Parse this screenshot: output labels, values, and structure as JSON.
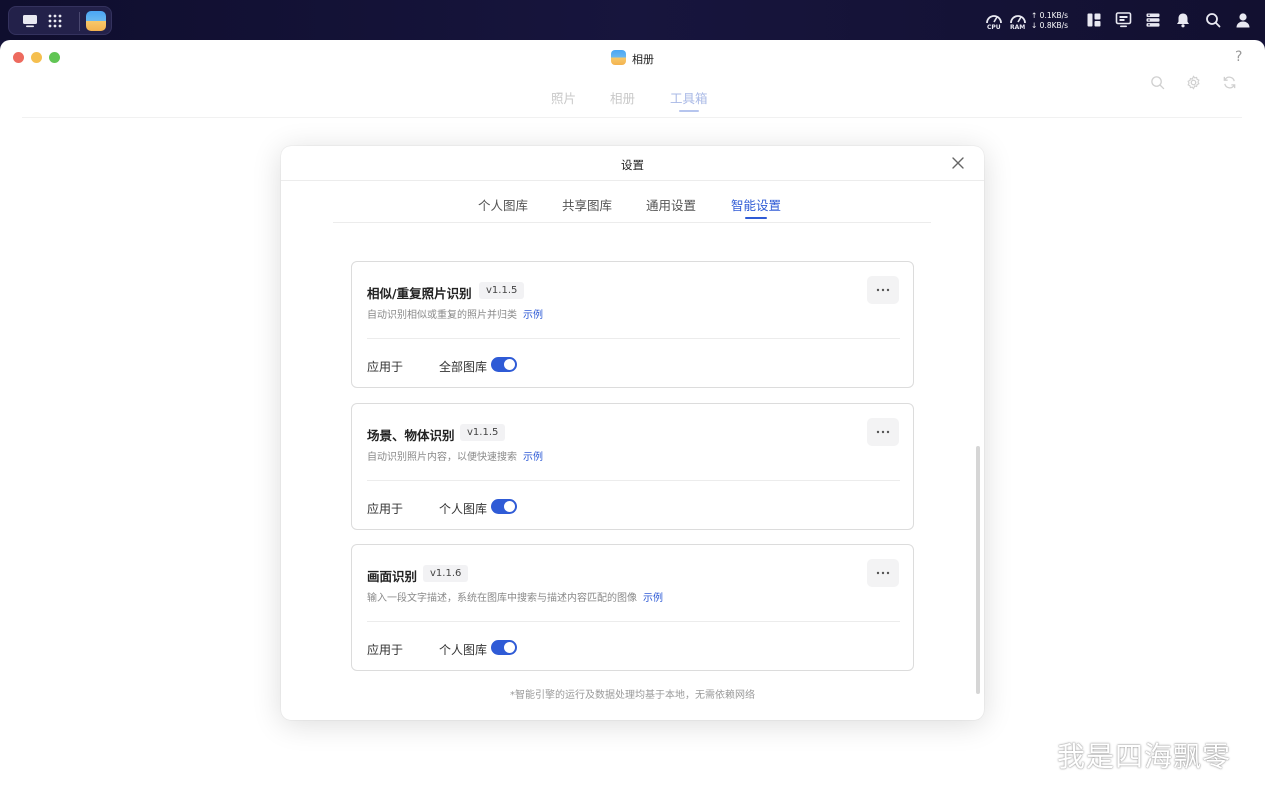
{
  "window": {
    "title": "相册",
    "help_label": "?"
  },
  "app_tabs": [
    {
      "label": "照片",
      "active": false
    },
    {
      "label": "相册",
      "active": false
    },
    {
      "label": "工具箱",
      "active": true
    }
  ],
  "system_bar": {
    "cpu_label": "CPU",
    "ram_label": "RAM",
    "upload_speed": "↑ 0.1KB/s",
    "download_speed": "↓ 0.8KB/s"
  },
  "settings_modal": {
    "title": "设置",
    "tabs": [
      {
        "label": "个人图库",
        "active": false
      },
      {
        "label": "共享图库",
        "active": false
      },
      {
        "label": "通用设置",
        "active": false
      },
      {
        "label": "智能设置",
        "active": true
      }
    ],
    "features": [
      {
        "title": "相似/重复照片识别",
        "version": "v1.1.5",
        "description": "自动识别相似或重复的照片并归类",
        "example_link": "示例",
        "more_label": "···",
        "apply_label": "应用于",
        "apply_value": "全部图库",
        "enabled": true
      },
      {
        "title": "场景、物体识别",
        "version": "v1.1.5",
        "description": "自动识别照片内容，以便快速搜索",
        "example_link": "示例",
        "more_label": "···",
        "apply_label": "应用于",
        "apply_value": "个人图库",
        "enabled": true
      },
      {
        "title": "画面识别",
        "version": "v1.1.6",
        "description": "输入一段文字描述，系统在图库中搜索与描述内容匹配的图像",
        "example_link": "示例",
        "more_label": "···",
        "apply_label": "应用于",
        "apply_value": "个人图库",
        "enabled": true
      }
    ],
    "footnote": "*智能引擎的运行及数据处理均基于本地，无需依赖网络"
  },
  "watermark": "我是四海飘零",
  "colors": {
    "accent": "#2f5bd6",
    "system_bar": "#16143a",
    "traffic_red": "#ed6a5e",
    "traffic_yellow": "#f5bf4f",
    "traffic_green": "#61c554"
  },
  "icons": {
    "dock": [
      "desktop-icon",
      "app-grid-icon",
      "photos-app-icon"
    ],
    "system_right": [
      "cpu-gauge-icon",
      "ram-gauge-icon",
      "widgets-icon",
      "monitor-icon",
      "server-icon",
      "bell-icon",
      "search-icon",
      "user-icon"
    ],
    "app_toolbar": [
      "search-icon",
      "gear-icon",
      "refresh-icon"
    ]
  }
}
